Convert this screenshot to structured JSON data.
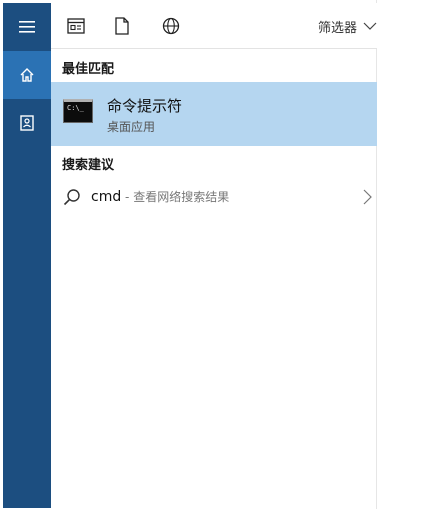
{
  "topbar": {
    "filter_label": "筛选器"
  },
  "best_match": {
    "section_title": "最佳匹配",
    "app_name": "命令提示符",
    "app_type": "桌面应用",
    "icon_text": "C:\\_"
  },
  "suggestions": {
    "section_title": "搜索建议",
    "items": [
      {
        "query": "cmd",
        "separator": " - ",
        "hint": "查看网络搜索结果"
      }
    ]
  },
  "colors": {
    "rail": "#1c4e80",
    "rail_active": "#2b72b4",
    "highlight": "#b5d6f0"
  }
}
